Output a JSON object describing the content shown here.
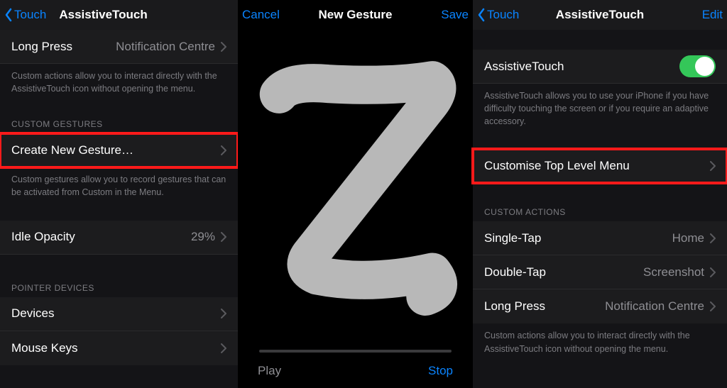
{
  "screen1": {
    "nav": {
      "back": "Touch",
      "title": "AssistiveTouch"
    },
    "longPress": {
      "label": "Long Press",
      "value": "Notification Centre"
    },
    "actionsFooter": "Custom actions allow you to interact directly with the AssistiveTouch icon without opening the menu.",
    "gesturesHeader": "CUSTOM GESTURES",
    "createGesture": "Create New Gesture…",
    "gesturesFooter": "Custom gestures allow you to record gestures that can be activated from Custom in the Menu.",
    "idleOpacity": {
      "label": "Idle Opacity",
      "value": "29%"
    },
    "pointerHeader": "POINTER DEVICES",
    "devices": "Devices",
    "mouseKeys": "Mouse Keys"
  },
  "screen2": {
    "nav": {
      "cancel": "Cancel",
      "title": "New Gesture",
      "save": "Save"
    },
    "play": "Play",
    "stop": "Stop"
  },
  "screen3": {
    "nav": {
      "back": "Touch",
      "title": "AssistiveTouch",
      "edit": "Edit"
    },
    "toggleLabel": "AssistiveTouch",
    "toggleFooter": "AssistiveTouch allows you to use your iPhone if you have difficulty touching the screen or if you require an adaptive accessory.",
    "customiseMenu": "Customise Top Level Menu",
    "actionsHeader": "CUSTOM ACTIONS",
    "singleTap": {
      "label": "Single-Tap",
      "value": "Home"
    },
    "doubleTap": {
      "label": "Double-Tap",
      "value": "Screenshot"
    },
    "longPress": {
      "label": "Long Press",
      "value": "Notification Centre"
    },
    "actionsFooter": "Custom actions allow you to interact directly with the AssistiveTouch icon without opening the menu."
  }
}
